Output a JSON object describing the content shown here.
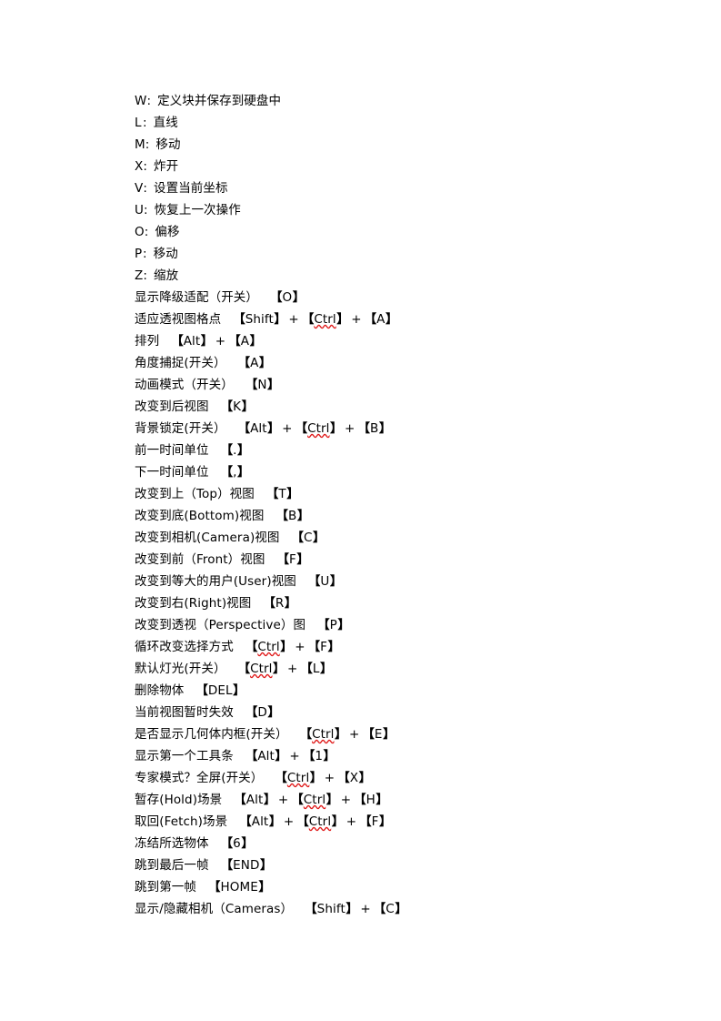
{
  "document": {
    "page_background": "#ffffff",
    "text_color": "#000000",
    "spellcheck_underline_color": "#e01b1b",
    "bracket_open": "【",
    "bracket_close": "】",
    "plus_separator": "+",
    "colon_separator": ":"
  },
  "letter_shortcuts": [
    {
      "key": "W",
      "description": "定义块并保存到硬盘中"
    },
    {
      "key": "L",
      "description": "直线"
    },
    {
      "key": "M",
      "description": "移动"
    },
    {
      "key": "X",
      "description": "炸开"
    },
    {
      "key": "V",
      "description": "设置当前坐标"
    },
    {
      "key": "U",
      "description": "恢复上一次操作"
    },
    {
      "key": "O",
      "description": "偏移"
    },
    {
      "key": "P",
      "description": "移动"
    },
    {
      "key": "Z",
      "description": "缩放"
    }
  ],
  "command_shortcuts": [
    {
      "description": "显示降级适配（开关）",
      "keys": [
        "O"
      ]
    },
    {
      "description": "适应透视图格点",
      "keys": [
        "Shift",
        "Ctrl",
        "A"
      ]
    },
    {
      "description": "排列",
      "keys": [
        "Alt",
        "A"
      ]
    },
    {
      "description": "角度捕捉(开关）",
      "keys": [
        "A"
      ]
    },
    {
      "description": "动画模式（开关）",
      "keys": [
        "N"
      ]
    },
    {
      "description": "改变到后视图",
      "keys": [
        "K"
      ]
    },
    {
      "description": "背景锁定(开关）",
      "keys": [
        "Alt",
        "Ctrl",
        "B"
      ]
    },
    {
      "description": "前一时间单位",
      "keys": [
        "."
      ]
    },
    {
      "description": "下一时间单位",
      "keys": [
        ","
      ]
    },
    {
      "description": "改变到上（Top）视图",
      "keys": [
        "T"
      ]
    },
    {
      "description": "改变到底(Bottom)视图",
      "keys": [
        "B"
      ]
    },
    {
      "description": "改变到相机(Camera)视图",
      "keys": [
        "C"
      ]
    },
    {
      "description": "改变到前（Front）视图",
      "keys": [
        "F"
      ]
    },
    {
      "description": "改变到等大的用户(User)视图",
      "keys": [
        "U"
      ]
    },
    {
      "description": "改变到右(Right)视图",
      "keys": [
        "R"
      ]
    },
    {
      "description": "改变到透视（Perspective）图",
      "keys": [
        "P"
      ]
    },
    {
      "description": "循环改变选择方式",
      "keys": [
        "Ctrl",
        "F"
      ]
    },
    {
      "description": "默认灯光(开关）",
      "keys": [
        "Ctrl",
        "L"
      ]
    },
    {
      "description": "删除物体",
      "keys": [
        "DEL"
      ]
    },
    {
      "description": "当前视图暂时失效",
      "keys": [
        "D"
      ]
    },
    {
      "description": "是否显示几何体内框(开关）",
      "keys": [
        "Ctrl",
        "E"
      ]
    },
    {
      "description": "显示第一个工具条",
      "keys": [
        "Alt",
        "1"
      ]
    },
    {
      "description": "专家模式？全屏(开关）",
      "keys": [
        "Ctrl",
        "X"
      ]
    },
    {
      "description": "暂存(Hold)场景",
      "keys": [
        "Alt",
        "Ctrl",
        "H"
      ]
    },
    {
      "description": "取回(Fetch)场景",
      "keys": [
        "Alt",
        "Ctrl",
        "F"
      ]
    },
    {
      "description": "冻结所选物体",
      "keys": [
        "6"
      ]
    },
    {
      "description": "跳到最后一帧",
      "keys": [
        "END"
      ]
    },
    {
      "description": "跳到第一帧",
      "keys": [
        "HOME"
      ]
    },
    {
      "description": "显示/隐藏相机（Cameras）",
      "keys": [
        "Shift",
        "C"
      ]
    }
  ],
  "misspelled_tokens": [
    "Ctrl"
  ]
}
